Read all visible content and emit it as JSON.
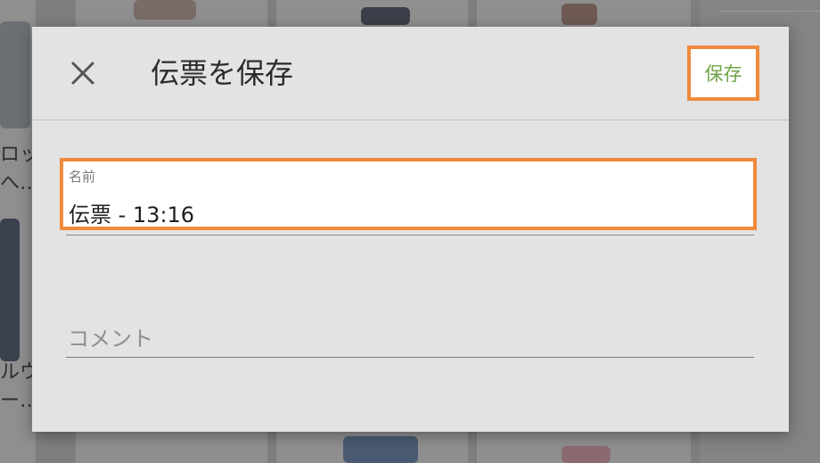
{
  "background": {
    "text_fragments": [
      "ロッ",
      "へ…",
      "ルウ",
      "ー…"
    ]
  },
  "dialog": {
    "title": "伝票を保存",
    "close_icon": "close-icon",
    "save_label": "保存",
    "name_field": {
      "label": "名前",
      "value": "伝票 - 13:16"
    },
    "comment_field": {
      "placeholder": "コメント",
      "value": ""
    }
  },
  "colors": {
    "highlight": "#f08a3c",
    "save_text": "#6ea346",
    "dialog_bg": "#e3e3e3"
  }
}
